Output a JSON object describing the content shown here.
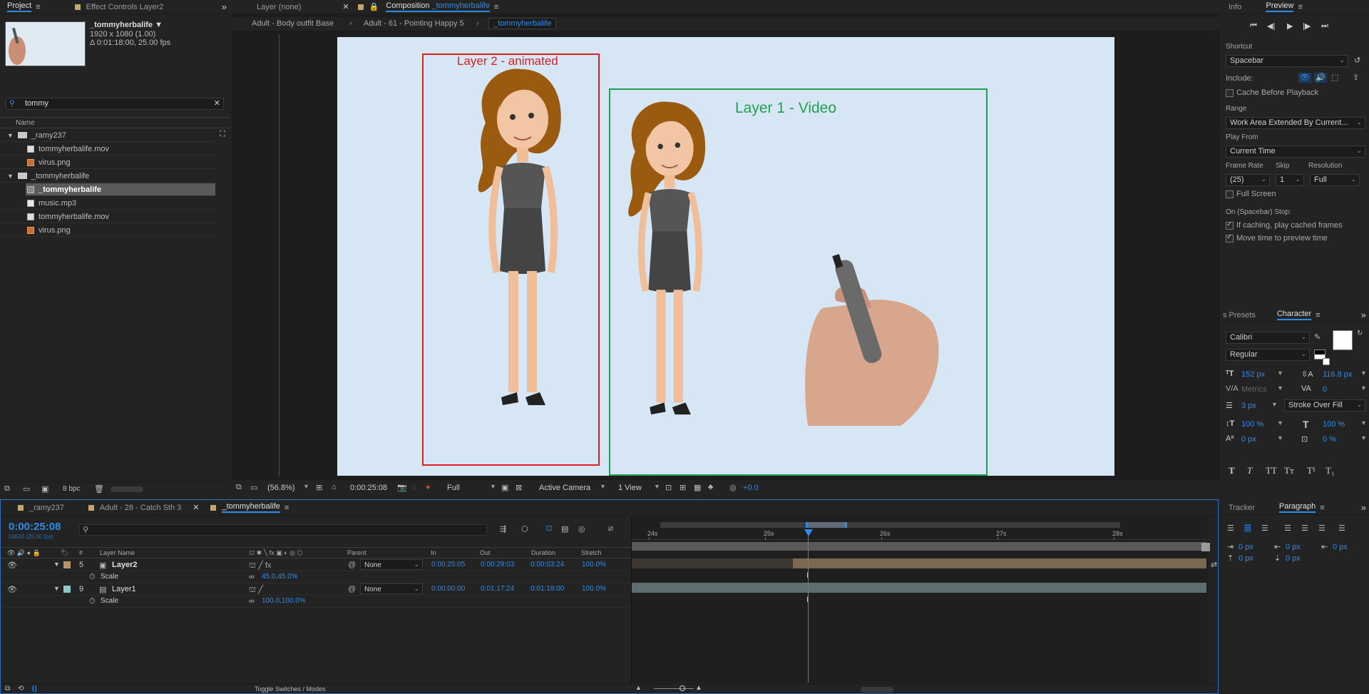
{
  "project": {
    "tabs": [
      {
        "label": "Project"
      },
      {
        "label": "Effect Controls Layer2"
      }
    ],
    "thumb_name": "_tommyherbalife ▼",
    "thumb_line1": "1920 x 1080 (1.00)",
    "thumb_line2": "Δ 0:01:18:00, 25.00 fps",
    "search_value": "tommy",
    "name_header": "Name",
    "items": [
      {
        "label": "_ramy237",
        "icon": "folder",
        "indent": 0,
        "twirl": "▼"
      },
      {
        "label": "tommyherbalife.mov",
        "icon": "mov",
        "indent": 1
      },
      {
        "label": "virus.png",
        "icon": "png",
        "indent": 1
      },
      {
        "label": "_tommyherbalife",
        "icon": "folder",
        "indent": 0,
        "twirl": "▼"
      },
      {
        "label": "_tommyherbalife",
        "icon": "comp",
        "indent": 1,
        "selected": true
      },
      {
        "label": "music.mp3",
        "icon": "mp3",
        "indent": 1
      },
      {
        "label": "tommyherbalife.mov",
        "icon": "mov",
        "indent": 1
      },
      {
        "label": "virus.png",
        "icon": "png",
        "indent": 1
      }
    ],
    "bpc": "8 bpc"
  },
  "viewer": {
    "tab_layer": "Layer (none)",
    "tab_comp_prefix": "Composition",
    "tab_comp_name": "_tommyherbalife",
    "breadcrumbs": [
      "Adult - Body outfit Base",
      "Adult - 61 - Pointing Happy 5",
      "_tommyherbalife"
    ],
    "layer2_label": "Layer 2 - animated",
    "layer1_label": "Layer 1 - Video",
    "zoom": "(56.8%)",
    "timecode": "0:00:25:08",
    "resolution": "Full",
    "camera": "Active Camera",
    "view": "1 View",
    "exposure": "+0.0"
  },
  "preview": {
    "tabs": [
      {
        "label": "Info"
      },
      {
        "label": "Preview"
      }
    ],
    "shortcut_label": "Shortcut",
    "shortcut_value": "Spacebar",
    "include_label": "Include:",
    "cache_label": "Cache Before Playback",
    "range_label": "Range",
    "range_value": "Work Area Extended By Current...",
    "playfrom_label": "Play From",
    "playfrom_value": "Current Time",
    "framerate_label": "Frame Rate",
    "skip_label": "Skip",
    "resolution_label": "Resolution",
    "framerate_value": "(25)",
    "skip_value": "1",
    "resolution_value": "Full",
    "fullscreen_label": "Full Screen",
    "stop_label": "On (Spacebar) Stop:",
    "ifcaching_label": "If caching, play cached frames",
    "movetime_label": "Move time to preview time"
  },
  "character": {
    "tabs": [
      {
        "label": "s Presets"
      },
      {
        "label": "Character"
      }
    ],
    "font": "Calibri",
    "style": "Regular",
    "size": "152 px",
    "leading": "116.8 px",
    "kerning": "Metrics",
    "tracking": "0",
    "stroke": "3 px",
    "stroke_mode": "Stroke Over Fill",
    "vscale": "100 %",
    "hscale": "100 %",
    "baseline": "0 px",
    "tsume": "0 %",
    "styles": [
      "T",
      "T",
      "TT",
      "Tт",
      "T¹",
      "T₁"
    ],
    "fill_color": "#ffffff"
  },
  "paragraph": {
    "tabs": [
      {
        "label": "Tracker"
      },
      {
        "label": "Paragraph"
      }
    ],
    "indent_left": "0 px",
    "indent_first": "0 px",
    "indent_right": "0 px",
    "space_before": "0 px",
    "space_after": "0 px"
  },
  "timeline": {
    "tabs": [
      {
        "label": "_ramy237"
      },
      {
        "label": "Adult - 28 - Catch Sth 3"
      },
      {
        "label": "_tommyherbalife"
      }
    ],
    "timecode": "0:00:25:08",
    "frames": "00633 (25.00 fps)",
    "headers": {
      "num": "#",
      "layer_name": "Layer Name",
      "parent": "Parent",
      "in": "In",
      "out": "Out",
      "duration": "Duration",
      "stretch": "Stretch"
    },
    "ruler": [
      "24s",
      "25s",
      "26s",
      "27s",
      "28s"
    ],
    "layers": [
      {
        "num": "5",
        "name": "Layer2",
        "parent": "None",
        "in": "0:00:25:05",
        "out": "0:00:29:03",
        "duration": "0:00:03:24",
        "stretch": "100.0%",
        "prop": "Scale",
        "prop_value": "45.0,45.0%",
        "label_color": "#b6946a"
      },
      {
        "num": "9",
        "name": "Layer1",
        "parent": "None",
        "in": "0:00:00:00",
        "out": "0:01:17:24",
        "duration": "0:01:18:00",
        "stretch": "100.0%",
        "prop": "Scale",
        "prop_value": "100.0,100.0%",
        "label_color": "#8fc6c6"
      }
    ],
    "toggle_label": "Toggle Switches / Modes"
  }
}
